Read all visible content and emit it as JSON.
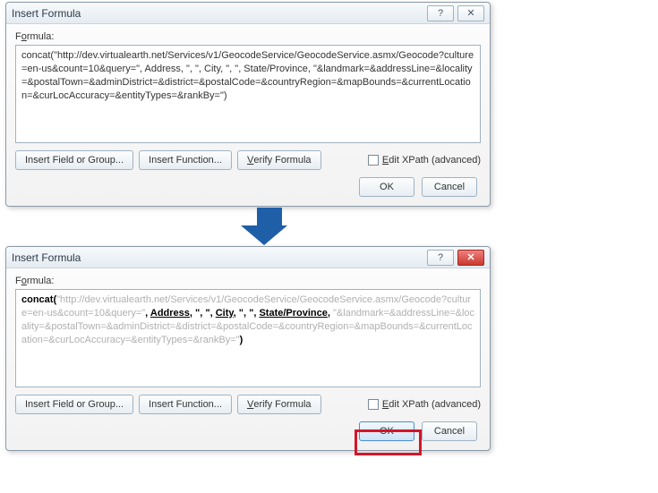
{
  "dialog1": {
    "title": "Insert Formula",
    "formula_label_pre": "F",
    "formula_label_u": "o",
    "formula_label_post": "rmula:",
    "formula_text": "concat(\"http://dev.virtualearth.net/Services/v1/GeocodeService/GeocodeService.asmx/Geocode?culture=en-us&count=10&query=\", Address, \", \", City, \", \", State/Province, \"&landmark=&addressLine=&locality=&postalTown=&adminDistrict=&district=&postalCode=&countryRegion=&mapBounds=&currentLocation=&curLocAccuracy=&entityTypes=&rankBy=\")",
    "btn_insert_field": "Insert Field or Group...",
    "btn_insert_fn": "Insert Function...",
    "btn_verify_pre": "",
    "btn_verify_u": "V",
    "btn_verify_post": "erify Formula",
    "edit_xpath_pre": "",
    "edit_xpath_u": "E",
    "edit_xpath_post": "dit XPath (advanced)",
    "ok": "OK",
    "cancel": "Cancel"
  },
  "dialog2": {
    "title": "Insert Formula",
    "formula_label_pre": "F",
    "formula_label_u": "o",
    "formula_label_post": "rmula:",
    "rich": {
      "concat": "concat(",
      "g1": "\"http://dev.virtualearth.net/Services/v1/GeocodeService/GeocodeService.asmx/Geocode?culture=en-us&count=10&query=\"",
      "sep": ", ",
      "addr": "Address",
      "q1": "\", \"",
      "city": "City",
      "q2": "\", \"",
      "state": "State/Province",
      "g2": "\"&landmark=&addressLine=&locality=&postalTown=&adminDistrict=&district=&postalCode=&countryRegion=&mapBounds=&currentLocation=&curLocAccuracy=&entityTypes=&rankBy=\"",
      "close": ")"
    },
    "btn_insert_field": "Insert Field or Group...",
    "btn_insert_fn": "Insert Function...",
    "btn_verify_pre": "",
    "btn_verify_u": "V",
    "btn_verify_post": "erify Formula",
    "edit_xpath_pre": "",
    "edit_xpath_u": "E",
    "edit_xpath_post": "dit XPath (advanced)",
    "ok": "OK",
    "cancel": "Cancel"
  }
}
